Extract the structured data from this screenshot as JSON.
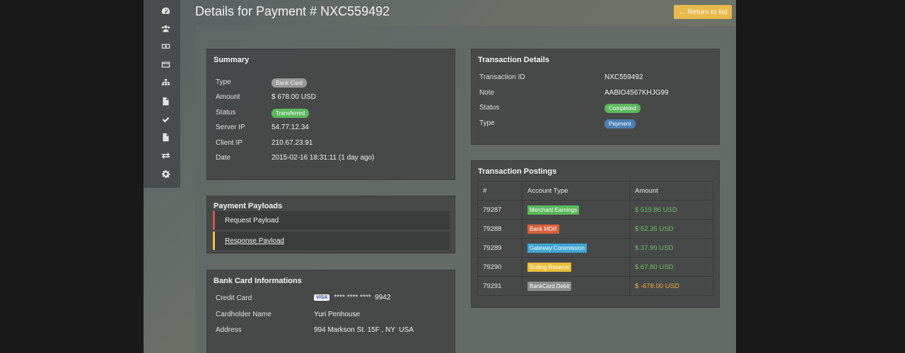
{
  "page": {
    "title": "Details for Payment # NXC559492",
    "return_label": "Return to list"
  },
  "sidebar": {
    "icons": [
      "dashboard-icon",
      "users-icon",
      "money-icon",
      "credit-card-icon",
      "sitemap-icon",
      "document-icon",
      "check-icon",
      "file-icon",
      "exchange-icon",
      "gear-icon"
    ]
  },
  "summary": {
    "title": "Summary",
    "rows": [
      {
        "label": "Type",
        "value": "Bank Card"
      },
      {
        "label": "Amount",
        "value": "$ 678.00 USD"
      },
      {
        "label": "Status",
        "value": "Transferred"
      },
      {
        "label": "Server IP",
        "value": "54.77.12.34"
      },
      {
        "label": "Client IP",
        "value": "210.67.23.91"
      },
      {
        "label": "Date",
        "value": "2015-02-16 18:31:11 (1 day ago)"
      }
    ]
  },
  "payloads": {
    "title": "Payment Payloads",
    "items": [
      "Request Payload",
      "Response Payload"
    ]
  },
  "bank_card": {
    "title": "Bank Card Informations",
    "rows": [
      {
        "label": "Credit Card",
        "value": "**** **** ****  9942",
        "brand": "VISA"
      },
      {
        "label": "Cardholder Name",
        "value": "Yuri Penhouse"
      },
      {
        "label": "Address",
        "value": "994 Markson St. 15F , NY  USA"
      }
    ]
  },
  "transaction_details": {
    "title": "Transaction Details",
    "rows": [
      {
        "label": "Transaction ID",
        "value": "NXC559492"
      },
      {
        "label": "Note",
        "value": "AABIO4567KHJG99"
      },
      {
        "label": "Status",
        "value": "Completed"
      },
      {
        "label": "Type",
        "value": "Payment"
      }
    ]
  },
  "postings": {
    "title": "Transaction Postings",
    "columns": [
      "#",
      "Account Type",
      "Amount"
    ],
    "rows": [
      {
        "id": "79287",
        "account": "Merchant Earnings",
        "color": "#5cb85c",
        "amount": "$ 519.86 USD",
        "sign": "pos"
      },
      {
        "id": "79288",
        "account": "Bank MDR",
        "color": "#d9603b",
        "amount": "$ 52.35 USD",
        "sign": "pos"
      },
      {
        "id": "79289",
        "account": "Gateway Commission",
        "color": "#3fa6d6",
        "amount": "$ 37.99 USD",
        "sign": "pos"
      },
      {
        "id": "79290",
        "account": "Rolling Reserve",
        "color": "#eabf3a",
        "amount": "$ 67.80 USD",
        "sign": "pos"
      },
      {
        "id": "79291",
        "account": "BankCard Debit",
        "color": "#8e8e8e",
        "amount": "$ -678.00 USD",
        "sign": "neg"
      }
    ]
  }
}
